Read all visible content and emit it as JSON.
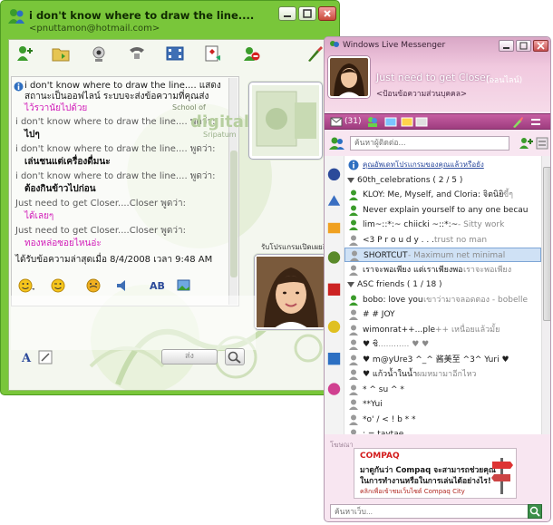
{
  "conversation": {
    "title": "i don't know where to draw the line....",
    "email": "<pnuttamon@hotmail.com>",
    "history": [
      {
        "kind": "info",
        "text": "i don't know where to draw the line.... แสดง"
      },
      {
        "kind": "info-cont",
        "text": "สถานะเป็นออฟไลน์ ระบบจะส่งข้อความที่คุณส่ง"
      },
      {
        "kind": "pink",
        "text": "ไว้รวานัยไปด้วย"
      },
      {
        "kind": "sender",
        "text": "i don't know where to draw the line.... พูดว่า:"
      },
      {
        "kind": "bold",
        "text": "ไปๆ"
      },
      {
        "kind": "sender",
        "text": "i don't know where to draw the line.... พูดว่า:"
      },
      {
        "kind": "bold",
        "text": "เล่นชนแต่เครื่องดื่มนะ"
      },
      {
        "kind": "sender",
        "text": "i don't know where to draw the line.... พูดว่า:"
      },
      {
        "kind": "bold",
        "text": "ต้องกินข้าวไปก่อน"
      },
      {
        "kind": "sender",
        "text": "Just need to get Closer....Closer พูดว่า:"
      },
      {
        "kind": "pink",
        "text": "ได้เลยๆ"
      },
      {
        "kind": "sender",
        "text": "Just need to get Closer....Closer พูดว่า:"
      },
      {
        "kind": "pink",
        "text": "ทองหล่อซอยไหนอ่ะ"
      },
      {
        "kind": "info",
        "text": "ได้รับข้อความล่าสุดเมื่อ 8/4/2008 เวลา 9:48 AM"
      }
    ],
    "remote_caption": "School of",
    "remote_brand": "digital",
    "remote_sub": "Sripatum",
    "own_caption": "รับโปรแกรมเปิดเผยสิ่งใหม่",
    "send_label": "ส่ง"
  },
  "messenger": {
    "window_title": "Windows Live Messenger",
    "display_name": "Just need to get Closer...",
    "status": "(ออนไลน์)",
    "personal_message": "<ป้อนข้อความส่วนบุคคล>",
    "mail_count": "(31)",
    "search_placeholder": "ค้นหาผู้ติดต่อ...",
    "rows": [
      {
        "type": "banner",
        "name": "คุณอัพเดทโปรแกรมของคุณแล้วหรือยัง",
        "msg": ""
      },
      {
        "type": "group",
        "name": "60th_celebrations ( 2 / 5 )",
        "msg": ""
      },
      {
        "type": "contact",
        "name": "KLOY: Me, Myself, and Cloria: จิตนิยิ",
        "msg": " ขี้ๆ",
        "icon": "online"
      },
      {
        "type": "contact",
        "name": "Never explain yourself to any one becau",
        "msg": "",
        "icon": "online"
      },
      {
        "type": "contact",
        "name": "lim~::*:~ chiicki ~::*:~",
        "msg": " - Sitty work",
        "icon": "online"
      },
      {
        "type": "contact",
        "name": "<3 P r o u d y . . .",
        "msg": "   trust no man",
        "icon": "offline"
      },
      {
        "type": "contact",
        "name": "SHORTCUT",
        "msg": " - Maximum net minimal",
        "icon": "offline",
        "selected": true
      },
      {
        "type": "contact",
        "name": "เราจะพอเพียง แต่เราเพียงพอ",
        "msg": "   เราจะพอเพียง",
        "icon": "offline"
      },
      {
        "type": "group",
        "name": "ASC friends ( 1 / 18 )",
        "msg": ""
      },
      {
        "type": "contact",
        "name": "bobo: love you",
        "msg": " เขาว่ามาจลอดตอง - bobelle",
        "icon": "online"
      },
      {
        "type": "contact",
        "name": "# # JOY",
        "msg": "",
        "icon": "offline"
      },
      {
        "type": "contact",
        "name": "wimonrat++...ple",
        "msg": "  ++ เหนื่อยแล้วมั้ย",
        "icon": "offline"
      },
      {
        "type": "contact",
        "name": "♥ ชิ",
        "msg": "  ............ ♥ ♥",
        "icon": "offline"
      },
      {
        "type": "contact",
        "name": "♥ m@yUre3 ^_^ 酱美至 ^3^ Yuri ♥",
        "msg": "",
        "icon": "offline"
      },
      {
        "type": "contact",
        "name": "♥ แก้วน้ำในน้ำ",
        "msg": "  ผมหมามาอีกไหว",
        "icon": "offline"
      },
      {
        "type": "contact",
        "name": "* ^ su ^ *",
        "msg": "",
        "icon": "offline"
      },
      {
        "type": "contact",
        "name": "**Yui",
        "msg": "",
        "icon": "offline"
      },
      {
        "type": "contact",
        "name": "*o' / < ! b * *",
        "msg": "",
        "icon": "offline"
      },
      {
        "type": "contact",
        "name": "; = taytae",
        "msg": "",
        "icon": "offline"
      }
    ],
    "footer_label": "โฆษณา",
    "ad": {
      "brand": "COMPAQ",
      "line1": "มาดูกันว่า Compaq จะสามารถช่วยคุณ",
      "line2": "ในการทำงานหรือในการเล่นได้อย่างไร!",
      "line3": "คลิกเพื่อเข้าชมเว็บไซต์ Compaq City"
    },
    "bottom_search_placeholder": "ค้นหาเว็บ..."
  }
}
